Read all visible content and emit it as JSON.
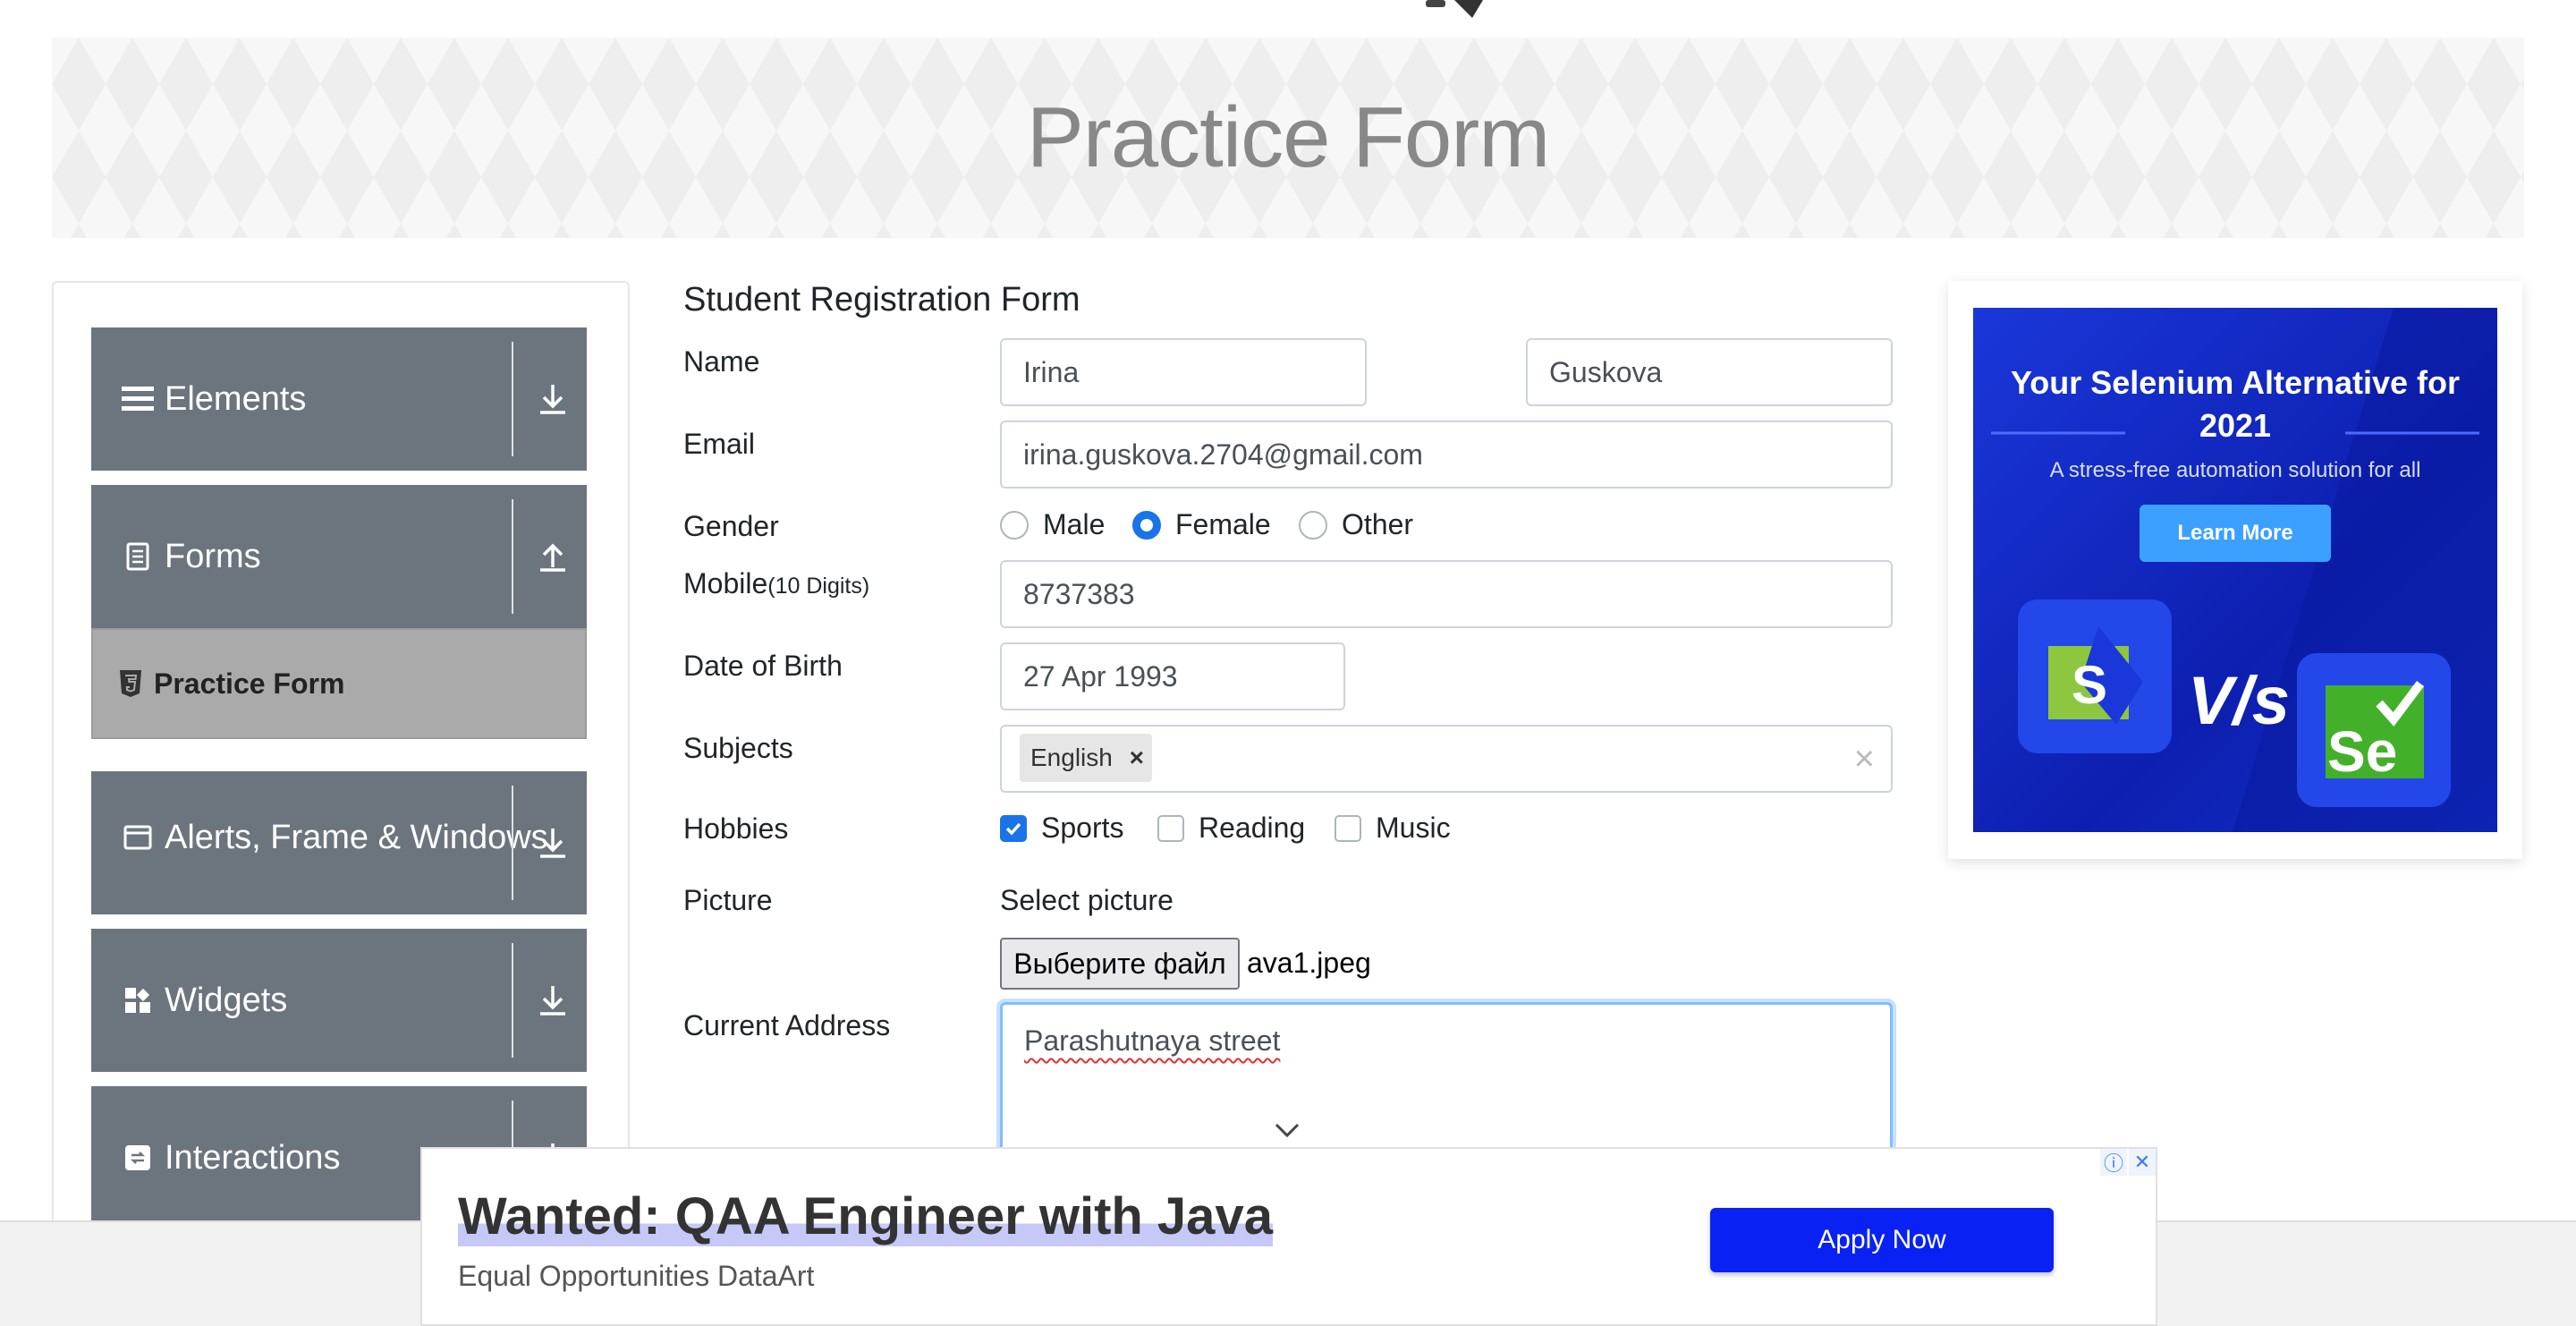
{
  "banner": {
    "title": "Practice Form"
  },
  "sidebar": {
    "groups": [
      {
        "label": "Elements",
        "icon": "menu-icon",
        "arrow": "download-arrow-icon"
      },
      {
        "label": "Forms",
        "icon": "document-icon",
        "arrow": "upload-arrow-icon"
      },
      {
        "label": "Alerts, Frame & Windows",
        "icon": "window-icon",
        "arrow": "download-arrow-icon"
      },
      {
        "label": "Widgets",
        "icon": "widgets-icon",
        "arrow": "download-arrow-icon"
      },
      {
        "label": "Interactions",
        "icon": "interactions-icon",
        "arrow": "download-arrow-icon"
      }
    ],
    "active_item": {
      "label": "Practice Form",
      "icon": "html5-icon"
    }
  },
  "form": {
    "title": "Student Registration Form",
    "labels": {
      "name": "Name",
      "email": "Email",
      "gender": "Gender",
      "mobile": "Mobile",
      "mobile_hint": "(10 Digits)",
      "dob": "Date of Birth",
      "subjects": "Subjects",
      "hobbies": "Hobbies",
      "picture": "Picture",
      "address": "Current Address"
    },
    "first_name": "Irina",
    "last_name": "Guskova",
    "email": "irina.guskova.2704@gmail.com",
    "gender_options": [
      "Male",
      "Female",
      "Other"
    ],
    "gender_selected": "Female",
    "mobile": "8737383",
    "dob": "27 Apr 1993",
    "subjects": [
      "English"
    ],
    "subject_remove": "×",
    "clear_all": "×",
    "hobbies": [
      {
        "label": "Sports",
        "checked": true
      },
      {
        "label": "Reading",
        "checked": false
      },
      {
        "label": "Music",
        "checked": false
      }
    ],
    "picture_caption": "Select picture",
    "file_button": "Выберите файл",
    "file_name": "ava1.jpeg",
    "address": "Parashutnaya street"
  },
  "ad_right": {
    "title": "Your Selenium Alternative for 2021",
    "subtitle": "A stress-free automation solution for all",
    "button": "Learn More",
    "vs": "V/s"
  },
  "ad_bottom": {
    "headline": "Wanted: QAA Engineer with Java",
    "sub": "Equal Opportunities DataArt",
    "button": "Apply Now",
    "info_icon": "ⓘ",
    "close_icon": "✕"
  },
  "colors": {
    "sidebar_group_bg": "#6c757d",
    "active_item_bg": "#aaaaaa",
    "accent": "#1a73e8",
    "apply_button": "#0a21f3"
  }
}
